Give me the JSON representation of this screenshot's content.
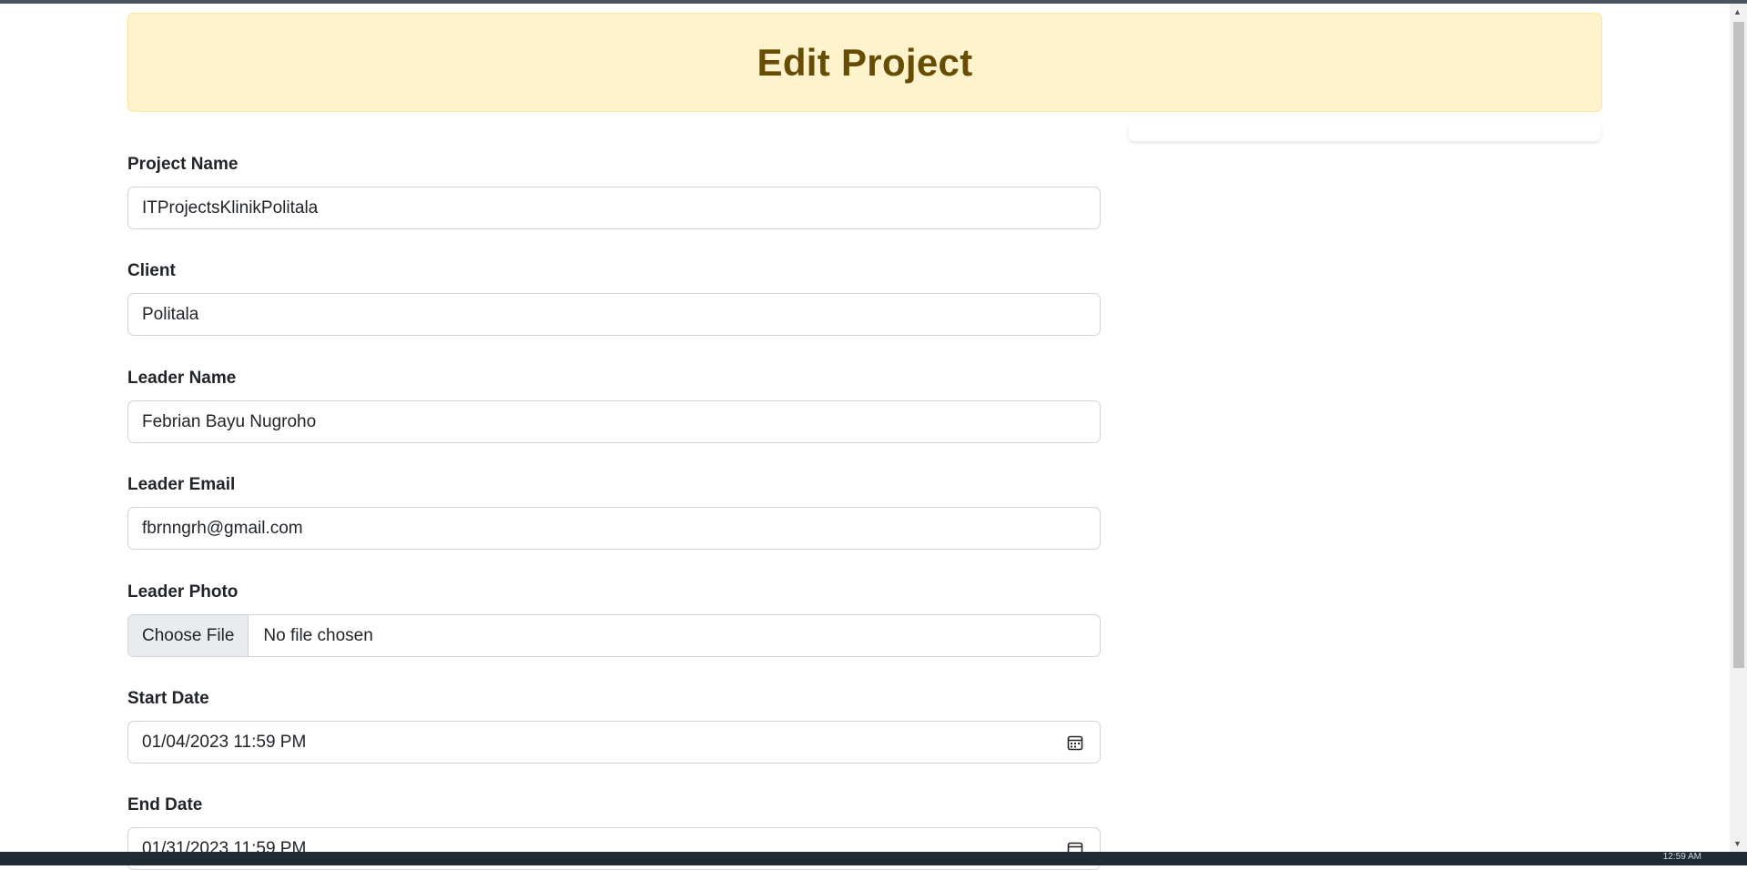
{
  "header": {
    "title": "Edit Project"
  },
  "form": {
    "project_name": {
      "label": "Project Name",
      "value": "ITProjectsKlinikPolitala"
    },
    "client": {
      "label": "Client",
      "value": "Politala"
    },
    "leader_name": {
      "label": "Leader Name",
      "value": "Febrian Bayu Nugroho"
    },
    "leader_email": {
      "label": "Leader Email",
      "value": "fbrnngrh@gmail.com"
    },
    "leader_photo": {
      "label": "Leader Photo",
      "button": "Choose File",
      "status": "No file chosen"
    },
    "start_date": {
      "label": "Start Date",
      "value": "01/04/2023 11:59 PM"
    },
    "end_date": {
      "label": "End Date",
      "value": "01/31/2023 11:59 PM"
    }
  },
  "taskbar": {
    "clock": "12:59 AM"
  },
  "colors": {
    "banner_bg": "#fff3cd",
    "banner_text": "#664d03",
    "input_border": "#ced4da",
    "file_button_bg": "#e9ecef"
  },
  "icons": [
    "calendar-icon",
    "scroll-up-arrow-icon",
    "scroll-down-arrow-icon"
  ]
}
